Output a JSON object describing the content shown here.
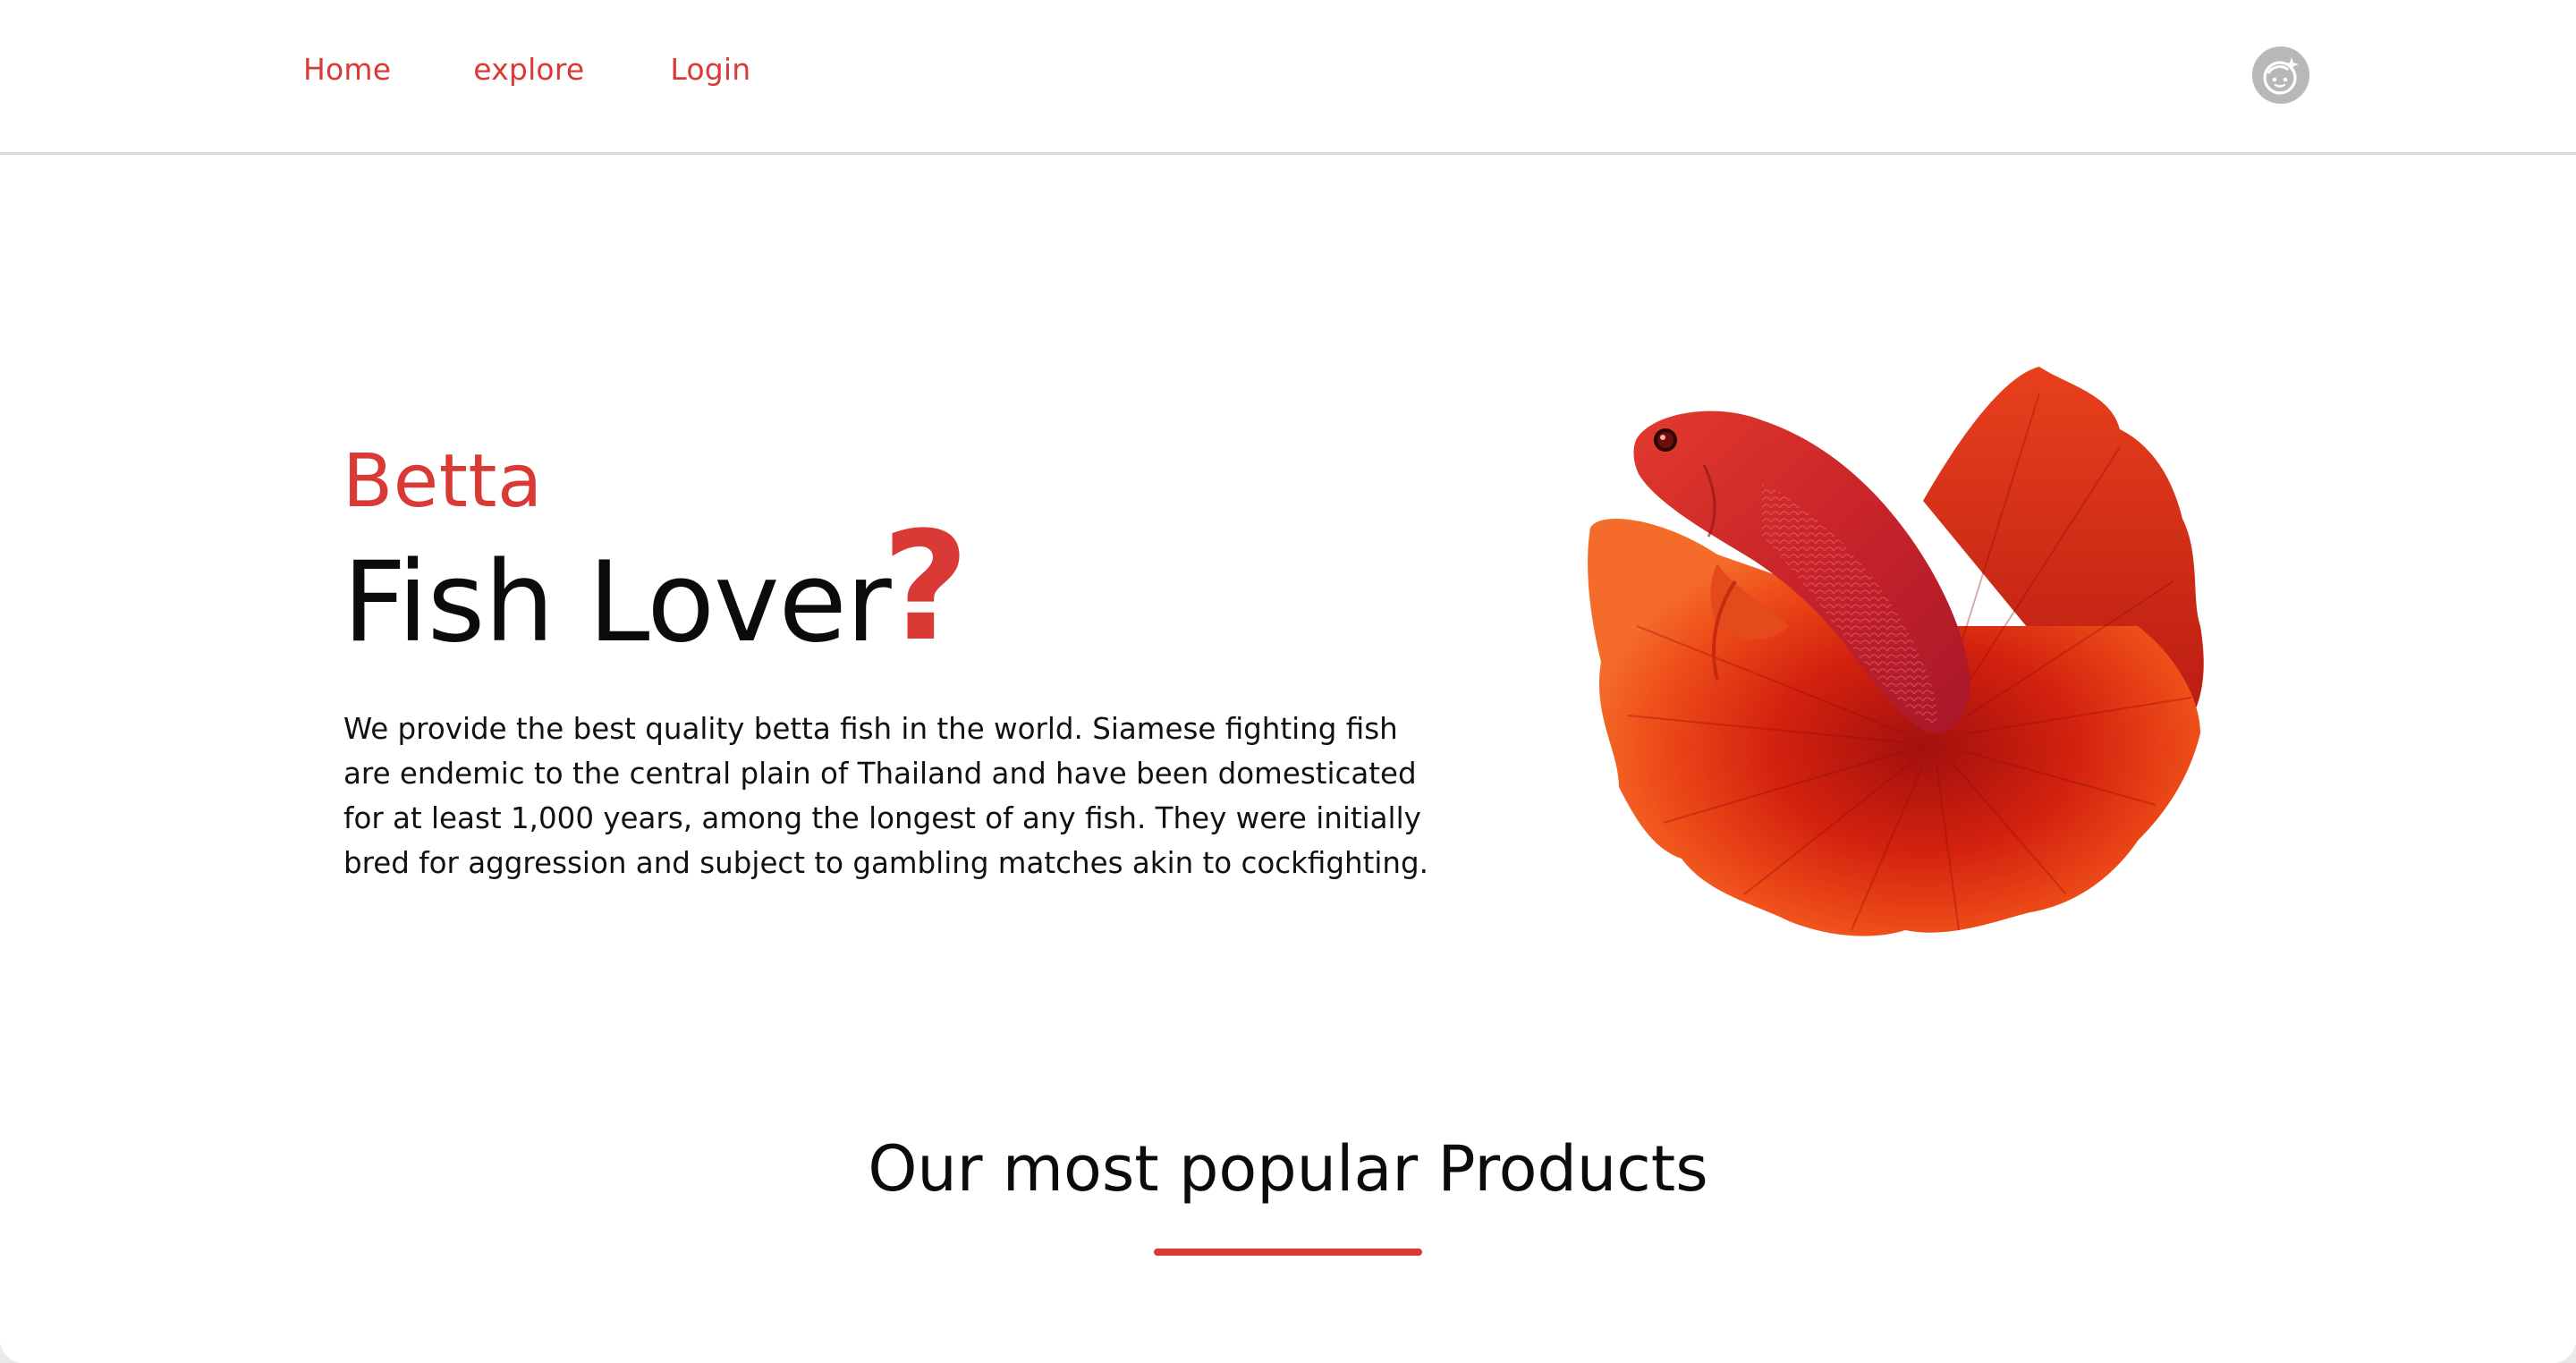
{
  "nav": {
    "home": "Home",
    "explore": "explore",
    "login": "Login"
  },
  "user": {
    "avatar_icon": "user-avatar-icon"
  },
  "hero": {
    "kicker": "Betta",
    "title": "Fish Lover",
    "mark": "?",
    "description": "We provide the best quality betta fish in the world. Siamese fighting fish are endemic to the central plain of Thailand and have been domesticated for at least 1,000 years, among the longest of any fish. They were initially bred for aggression and subject to gambling matches akin to cockfighting.",
    "image_icon": "betta-fish-image"
  },
  "products": {
    "title": "Our most popular Products"
  },
  "colors": {
    "accent": "#d93a35",
    "text": "#0b0b0b",
    "divider": "#d9d9d9",
    "avatar": "#b8b8b8"
  }
}
